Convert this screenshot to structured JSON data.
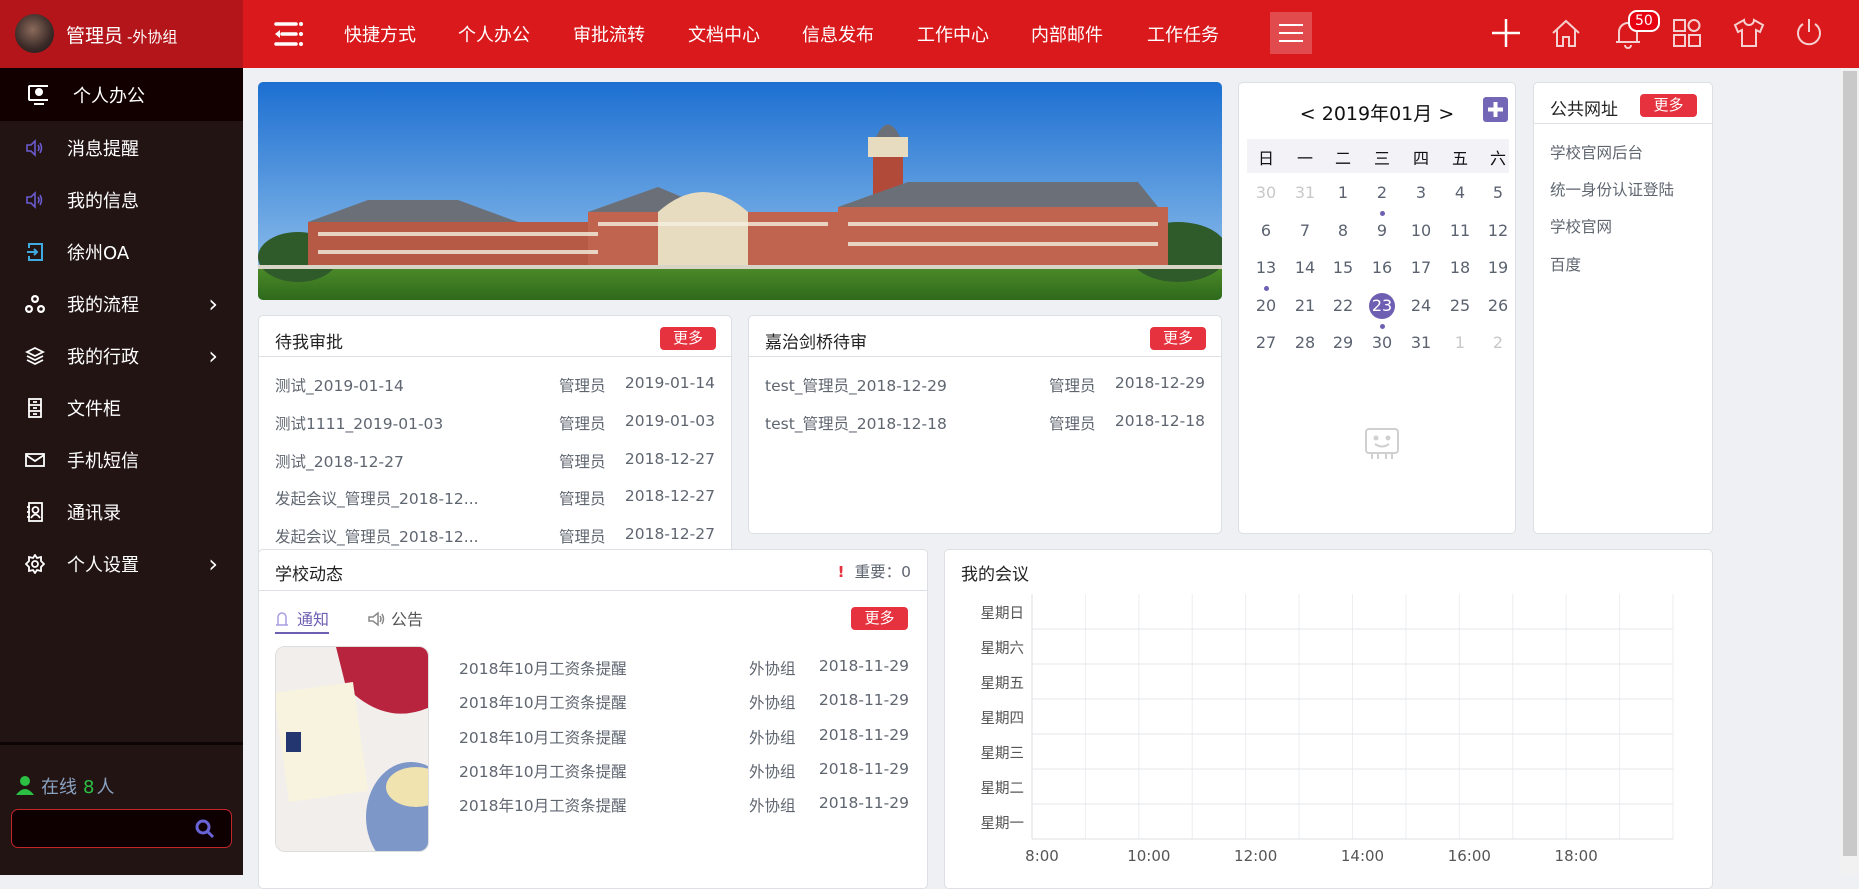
{
  "user": {
    "name": "管理员",
    "group": "-外协组"
  },
  "topnav": {
    "items": [
      "快捷方式",
      "个人办公",
      "审批流转",
      "文档中心",
      "信息发布",
      "工作中心",
      "内部邮件",
      "工作任务"
    ],
    "notification_count": "50",
    "icons": [
      "menu-toggle-icon",
      "hamburger-icon",
      "plus-icon",
      "home-icon",
      "bell-icon",
      "apps-icon",
      "shirt-icon",
      "power-icon"
    ]
  },
  "sidebar": {
    "active": {
      "label": "个人办公",
      "icon": "monitor-user-icon"
    },
    "items": [
      {
        "label": "消息提醒",
        "icon": "speaker-icon",
        "arrow": false
      },
      {
        "label": "我的信息",
        "icon": "speaker-icon",
        "arrow": false
      },
      {
        "label": "徐州OA",
        "icon": "login-icon",
        "arrow": false
      },
      {
        "label": "我的流程",
        "icon": "flow-icon",
        "arrow": true
      },
      {
        "label": "我的行政",
        "icon": "layers-icon",
        "arrow": true
      },
      {
        "label": "文件柜",
        "icon": "cabinet-icon",
        "arrow": false
      },
      {
        "label": "手机短信",
        "icon": "mail-icon",
        "arrow": false
      },
      {
        "label": "通讯录",
        "icon": "contacts-icon",
        "arrow": false
      },
      {
        "label": "个人设置",
        "icon": "gear-icon",
        "arrow": true
      }
    ],
    "online": {
      "label": "在线",
      "count": "8",
      "unit": "人"
    },
    "search": {
      "value": "",
      "placeholder": ""
    }
  },
  "calendar": {
    "prev": "<",
    "next": ">",
    "title": "2019年01月",
    "weekdays": [
      "日",
      "一",
      "二",
      "三",
      "四",
      "五",
      "六"
    ],
    "weeks": [
      [
        {
          "d": "30",
          "muted": true
        },
        {
          "d": "31",
          "muted": true
        },
        {
          "d": "1"
        },
        {
          "d": "2",
          "dot": true
        },
        {
          "d": "3"
        },
        {
          "d": "4"
        },
        {
          "d": "5"
        }
      ],
      [
        {
          "d": "6"
        },
        {
          "d": "7"
        },
        {
          "d": "8"
        },
        {
          "d": "9"
        },
        {
          "d": "10"
        },
        {
          "d": "11"
        },
        {
          "d": "12"
        }
      ],
      [
        {
          "d": "13",
          "dot": true
        },
        {
          "d": "14"
        },
        {
          "d": "15"
        },
        {
          "d": "16"
        },
        {
          "d": "17"
        },
        {
          "d": "18"
        },
        {
          "d": "19"
        }
      ],
      [
        {
          "d": "20"
        },
        {
          "d": "21"
        },
        {
          "d": "22"
        },
        {
          "d": "23",
          "today": true,
          "dot": true
        },
        {
          "d": "24"
        },
        {
          "d": "25"
        },
        {
          "d": "26"
        }
      ],
      [
        {
          "d": "27"
        },
        {
          "d": "28"
        },
        {
          "d": "29"
        },
        {
          "d": "30"
        },
        {
          "d": "31"
        },
        {
          "d": "1",
          "muted": true
        },
        {
          "d": "2",
          "muted": true
        }
      ]
    ],
    "accent": "#6f5fb3"
  },
  "public_links": {
    "title": "公共网址",
    "more": "更多",
    "items": [
      "学校官网后台",
      "统一身份认证登陆",
      "学校官网",
      "百度"
    ]
  },
  "pending": {
    "title": "待我审批",
    "more": "更多",
    "rows": [
      {
        "title": "测试_2019-01-14",
        "user": "管理员",
        "date": "2019-01-14"
      },
      {
        "title": "测试1111_2019-01-03",
        "user": "管理员",
        "date": "2019-01-03"
      },
      {
        "title": "测试_2018-12-27",
        "user": "管理员",
        "date": "2018-12-27"
      },
      {
        "title": "发起会议_管理员_2018-12...",
        "user": "管理员",
        "date": "2018-12-27"
      },
      {
        "title": "发起会议_管理员_2018-12...",
        "user": "管理员",
        "date": "2018-12-27"
      }
    ]
  },
  "jiazhi": {
    "title": "嘉治剑桥待审",
    "more": "更多",
    "rows": [
      {
        "title": "test_管理员_2018-12-29",
        "user": "管理员",
        "date": "2018-12-29"
      },
      {
        "title": "test_管理员_2018-12-18",
        "user": "管理员",
        "date": "2018-12-18"
      }
    ]
  },
  "news": {
    "title": "学校动态",
    "important_label": "重要：",
    "important_count": "0",
    "tabs": [
      {
        "label": "通知",
        "active": true
      },
      {
        "label": "公告",
        "active": false
      }
    ],
    "more": "更多",
    "rows": [
      {
        "title": "2018年10月工资条提醒",
        "group": "外协组",
        "date": "2018-11-29"
      },
      {
        "title": "2018年10月工资条提醒",
        "group": "外协组",
        "date": "2018-11-29"
      },
      {
        "title": "2018年10月工资条提醒",
        "group": "外协组",
        "date": "2018-11-29"
      },
      {
        "title": "2018年10月工资条提醒",
        "group": "外协组",
        "date": "2018-11-29"
      },
      {
        "title": "2018年10月工资条提醒",
        "group": "外协组",
        "date": "2018-11-29"
      }
    ]
  },
  "meetings": {
    "title": "我的会议"
  },
  "chart_data": {
    "type": "scatter",
    "title": "",
    "y_categories": [
      "星期日",
      "星期六",
      "星期五",
      "星期四",
      "星期三",
      "星期二",
      "星期一"
    ],
    "x_ticks": [
      "8:00",
      "10:00",
      "12:00",
      "14:00",
      "16:00",
      "18:00"
    ],
    "xlim": [
      8,
      20
    ],
    "grid": true,
    "series": []
  },
  "colors": {
    "header": "#d9191c",
    "sidebar": "#231414",
    "more_button": "#e5323e",
    "accent": "#6f5fb3"
  }
}
